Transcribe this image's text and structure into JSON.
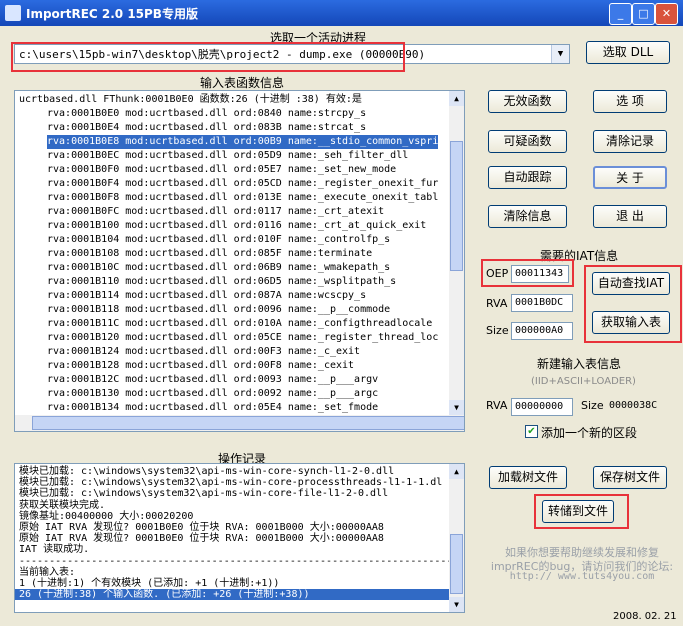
{
  "window": {
    "title": "ImportREC 2.0 15PB专用版",
    "controls": [
      "minimize",
      "maximize",
      "close"
    ]
  },
  "process": {
    "group_title": "选取一个活动进程",
    "selected": "c:\\users\\15pb-win7\\desktop\\脱壳\\project2 - dump.exe (00000E90)",
    "pick_dll_label": "选取 DLL"
  },
  "imports": {
    "group_title": "输入表函数信息",
    "rows": [
      "ucrtbased.dll FThunk:0001B0E0 函数数:26 (十进制 :38) 有效:是",
      "rva:0001B0E0 mod:ucrtbased.dll ord:0840 name:strcpy_s",
      "rva:0001B0E4 mod:ucrtbased.dll ord:083B name:strcat_s",
      "rva:0001B0E8 mod:ucrtbased.dll ord:00B9 name:__stdio_common_vspri",
      "rva:0001B0EC mod:ucrtbased.dll ord:05D9 name:_seh_filter_dll",
      "rva:0001B0F0 mod:ucrtbased.dll ord:05E7 name:_set_new_mode",
      "rva:0001B0F4 mod:ucrtbased.dll ord:05CD name:_register_onexit_fur",
      "rva:0001B0F8 mod:ucrtbased.dll ord:013E name:_execute_onexit_tabl",
      "rva:0001B0FC mod:ucrtbased.dll ord:0117 name:_crt_atexit",
      "rva:0001B100 mod:ucrtbased.dll ord:0116 name:_crt_at_quick_exit",
      "rva:0001B104 mod:ucrtbased.dll ord:010F name:_controlfp_s",
      "rva:0001B108 mod:ucrtbased.dll ord:085F name:terminate",
      "rva:0001B10C mod:ucrtbased.dll ord:06B9 name:_wmakepath_s",
      "rva:0001B110 mod:ucrtbased.dll ord:06D5 name:_wsplitpath_s",
      "rva:0001B114 mod:ucrtbased.dll ord:087A name:wcscpy_s",
      "rva:0001B118 mod:ucrtbased.dll ord:0096 name:__p__commode",
      "rva:0001B11C mod:ucrtbased.dll ord:010A name:_configthreadlocale",
      "rva:0001B120 mod:ucrtbased.dll ord:05CE name:_register_thread_loc",
      "rva:0001B124 mod:ucrtbased.dll ord:00F3 name:_c_exit",
      "rva:0001B128 mod:ucrtbased.dll ord:00F8 name:_cexit",
      "rva:0001B12C mod:ucrtbased.dll ord:0093 name:__p___argv",
      "rva:0001B130 mod:ucrtbased.dll ord:0092 name:__p___argc",
      "rva:0001B134 mod:ucrtbased.dll ord:05E4 name:_set_fmode"
    ],
    "selected_index": 3
  },
  "right_buttons": {
    "invalid_funcs": "无效函数",
    "options": "选 项",
    "suspicious_funcs": "可疑函数",
    "clear_log": "清除记录",
    "auto_trace": "自动跟踪",
    "about": "关 于",
    "clear_info": "清除信息",
    "exit": "退 出"
  },
  "iat": {
    "group_title": "需要的IAT信息",
    "oep_label": "OEP",
    "oep_value": "00011343",
    "rva_label": "RVA",
    "rva_value": "0001B0DC",
    "size_label": "Size",
    "size_value": "000000A0",
    "auto_find_label": "自动查找IAT",
    "get_imports_label": "获取输入表"
  },
  "new_imports": {
    "group_title": "新建输入表信息",
    "subtitle": "(IID+ASCII+LOADER)",
    "rva_label": "RVA",
    "rva_value": "00000000",
    "size_label": "Size",
    "size_value": "0000038C",
    "add_section_label": "添加一个新的区段",
    "add_section_checked": true
  },
  "log": {
    "group_title": "操作记录",
    "lines": [
      "模块已加载: c:\\windows\\system32\\api-ms-win-core-synch-l1-2-0.dll",
      "模块已加载: c:\\windows\\system32\\api-ms-win-core-processthreads-l1-1-1.dl",
      "模块已加载: c:\\windows\\system32\\api-ms-win-core-file-l1-2-0.dll",
      "获取关联模块完成.",
      "镜像基址:00400000 大小:00020200",
      "原始 IAT RVA 发现位? 0001B0E0 位于块 RVA: 0001B000 大小:00000AA8",
      "原始 IAT RVA 发现位? 0001B0E0 位于块 RVA: 0001B000 大小:00000AA8",
      "IAT 读取成功.",
      "------------------------------------------------------------------------",
      "当前输入表:",
      "1 (十进制:1) 个有效模块 (已添加: +1 (十进制:+1))",
      "26 (十进制:38) 个输入函数. (已添加: +26 (十进制:+38))"
    ],
    "selected_index": 11
  },
  "bottom_buttons": {
    "load_tree": "加载树文件",
    "save_tree": "保存树文件",
    "fix_dump": "转储到文件"
  },
  "promo": {
    "line1": "如果你想要帮助继续发展和修复",
    "line2": "imprREC的bug，请访问我们的论坛:",
    "url": "http:// www.tuts4you.com",
    "date": "2008. 02. 21"
  },
  "colors": {
    "highlight_box": "#e8323a",
    "selection": "#316ac5",
    "titlebar": "#1447b8"
  }
}
